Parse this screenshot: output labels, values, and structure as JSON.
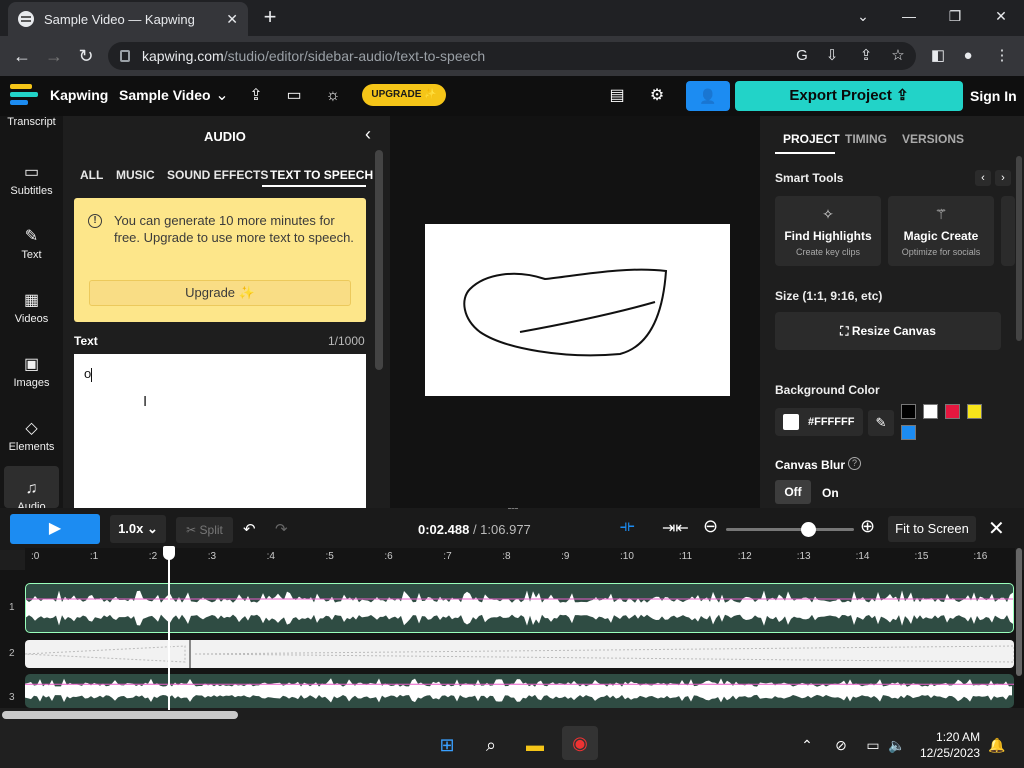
{
  "browser": {
    "tab_title": "Sample Video — Kapwing",
    "tab_close": "✕",
    "new_tab": "+",
    "url_host": "kapwing.com",
    "url_path": "/studio/editor/sidebar-audio/text-to-speech"
  },
  "header": {
    "brand": "Kapwing",
    "project_name": "Sample Video",
    "upgrade_label": "UPGRADE ✨",
    "export_label": "Export Project",
    "signin_label": "Sign In"
  },
  "left_nav": [
    {
      "label": "Transcript",
      "icon": "transcript-icon"
    },
    {
      "label": "Subtitles",
      "icon": "subtitles-icon"
    },
    {
      "label": "Text",
      "icon": "text-icon"
    },
    {
      "label": "Videos",
      "icon": "videos-icon"
    },
    {
      "label": "Images",
      "icon": "images-icon"
    },
    {
      "label": "Elements",
      "icon": "elements-icon"
    },
    {
      "label": "Audio",
      "icon": "audio-icon"
    }
  ],
  "audio_panel": {
    "title": "AUDIO",
    "tabs": [
      "ALL",
      "MUSIC",
      "SOUND EFFECTS",
      "TEXT TO SPEECH"
    ],
    "active_tab": "TEXT TO SPEECH",
    "notice": "You can generate 10 more minutes for free. Upgrade to use more text to speech.",
    "notice_button": "Upgrade ✨",
    "text_label": "Text",
    "text_count": "1/1000",
    "text_value": "o"
  },
  "right_panel": {
    "tabs": [
      "PROJECT",
      "TIMING",
      "VERSIONS"
    ],
    "active_tab": "PROJECT",
    "smart_tools_label": "Smart Tools",
    "cards": [
      {
        "name": "Find Highlights",
        "sub": "Create key clips"
      },
      {
        "name": "Magic Create",
        "sub": "Optimize for socials"
      }
    ],
    "size_label": "Size (1:1, 9:16, etc)",
    "resize_label": "Resize Canvas",
    "bg_label": "Background Color",
    "bg_value": "#FFFFFF",
    "swatches": [
      "#000000",
      "#ffffff",
      "#e5173f",
      "#f7e51b",
      "#1c8cf2"
    ],
    "blur_label": "Canvas Blur",
    "blur_off": "Off",
    "blur_on": "On"
  },
  "timeline": {
    "speed": "1.0x",
    "split_label": "✂ Split",
    "current_time": "0:02.488",
    "duration": "/ 1:06.977",
    "fit_label": "Fit to Screen",
    "ticks": [
      ":0",
      ":1",
      ":2",
      ":3",
      ":4",
      ":5",
      ":6",
      ":7",
      ":8",
      ":9",
      ":10",
      ":11",
      ":12",
      ":13",
      ":14",
      ":15",
      ":16"
    ],
    "track_numbers": [
      "1",
      "2",
      "3"
    ]
  },
  "taskbar": {
    "time": "1:20 AM",
    "date": "12/25/2023"
  }
}
